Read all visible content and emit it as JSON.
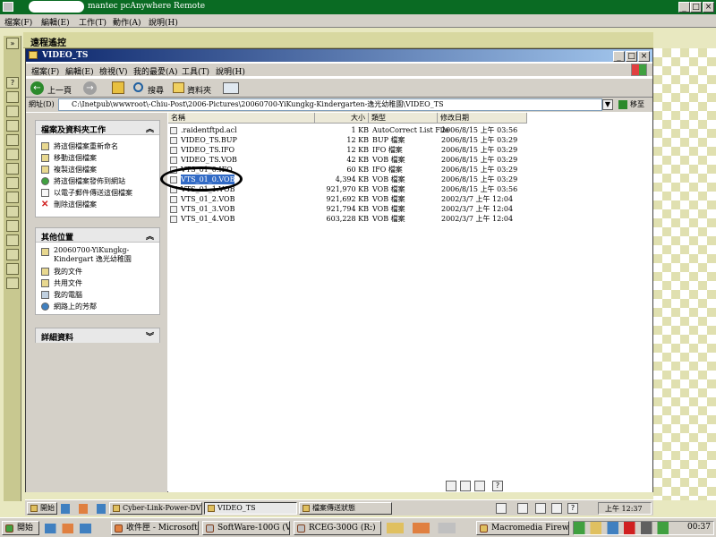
{
  "outer_window": {
    "title": "mantec pcAnywhere Remote",
    "menu": [
      "檔案(F)",
      "編輯(E)",
      "工作(T)",
      "動作(A)",
      "說明(H)"
    ],
    "controls": [
      "_",
      "□",
      "×"
    ]
  },
  "host_header": "遠程遙控",
  "inner_window": {
    "title": "VIDEO_TS",
    "menu": [
      "檔案(F)",
      "編輯(E)",
      "檢視(V)",
      "我的最愛(A)",
      "工具(T)",
      "說明(H)"
    ],
    "controls": [
      "_",
      "□",
      "×"
    ]
  },
  "toolbar": {
    "back": "上一頁",
    "search": "搜尋",
    "folders": "資料夾"
  },
  "address": {
    "label": "網址(D)",
    "value": "C:\\Inetpub\\wwwroot\\-Chiu-Post\\2006-Pictures\\20060700-YiKungkg-Kindergarten-逸光幼稚園\\VIDEO_TS",
    "go": "移至"
  },
  "task_pane": {
    "file_tasks": {
      "title": "檔案及資料夾工作",
      "items": [
        "將這個檔案重新命名",
        "移動這個檔案",
        "複製這個檔案",
        "將這個檔案發佈到網站",
        "以電子郵件傳送這個檔案",
        "刪除這個檔案"
      ]
    },
    "other_places": {
      "title": "其他位置",
      "items": [
        "20060700-YiKungkg-Kindergart 逸光幼稚園",
        "我的文件",
        "共用文件",
        "我的電腦",
        "網路上的芳鄰"
      ]
    },
    "details": {
      "title": "詳細資料"
    }
  },
  "file_list": {
    "columns": [
      "名稱",
      "大小",
      "類型",
      "修改日期"
    ],
    "rows": [
      {
        "name": ".raidentftpd.acl",
        "size": "1 KB",
        "type": "AutoCorrect List File",
        "date": "2006/8/15 上午 03:56"
      },
      {
        "name": "VIDEO_TS.BUP",
        "size": "12 KB",
        "type": "BUP 檔案",
        "date": "2006/8/15 上午 03:29"
      },
      {
        "name": "VIDEO_TS.IFO",
        "size": "12 KB",
        "type": "IFO 檔案",
        "date": "2006/8/15 上午 03:29"
      },
      {
        "name": "VIDEO_TS.VOB",
        "size": "42 KB",
        "type": "VOB 檔案",
        "date": "2006/8/15 上午 03:29"
      },
      {
        "name": "VTS_01_0.IFO",
        "size": "60 KB",
        "type": "IFO 檔案",
        "date": "2006/8/15 上午 03:29"
      },
      {
        "name": "VTS_01_0.VOB",
        "size": "4,394 KB",
        "type": "VOB 檔案",
        "date": "2006/8/15 上午 03:29",
        "selected": true
      },
      {
        "name": "VTS_01_1.VOB",
        "size": "921,970 KB",
        "type": "VOB 檔案",
        "date": "2006/8/15 上午 03:56"
      },
      {
        "name": "VTS_01_2.VOB",
        "size": "921,692 KB",
        "type": "VOB 檔案",
        "date": "2002/3/7 上午 12:04"
      },
      {
        "name": "VTS_01_3.VOB",
        "size": "921,794 KB",
        "type": "VOB 檔案",
        "date": "2002/3/7 上午 12:04"
      },
      {
        "name": "VTS_01_4.VOB",
        "size": "603,228 KB",
        "type": "VOB 檔案",
        "date": "2002/3/7 上午 12:04"
      }
    ]
  },
  "inner_taskbar": {
    "start": "開始",
    "buttons": [
      "Cyber-Link-Power-DVD-...",
      "VIDEO_TS",
      "檔案傳送狀態"
    ],
    "clock": "上午 12:37"
  },
  "outer_taskbar": {
    "start": "開始",
    "buttons": [
      "收件匣 - Microsoft...",
      "SoftWare-100G (V:)",
      "RCEG-300G (R:)",
      "Macromedia Firew..."
    ],
    "clock": "00:37"
  },
  "colors": {
    "outer_title": "#0a6b23",
    "inner_title_start": "#0a246a",
    "selection": "#316ac5"
  }
}
